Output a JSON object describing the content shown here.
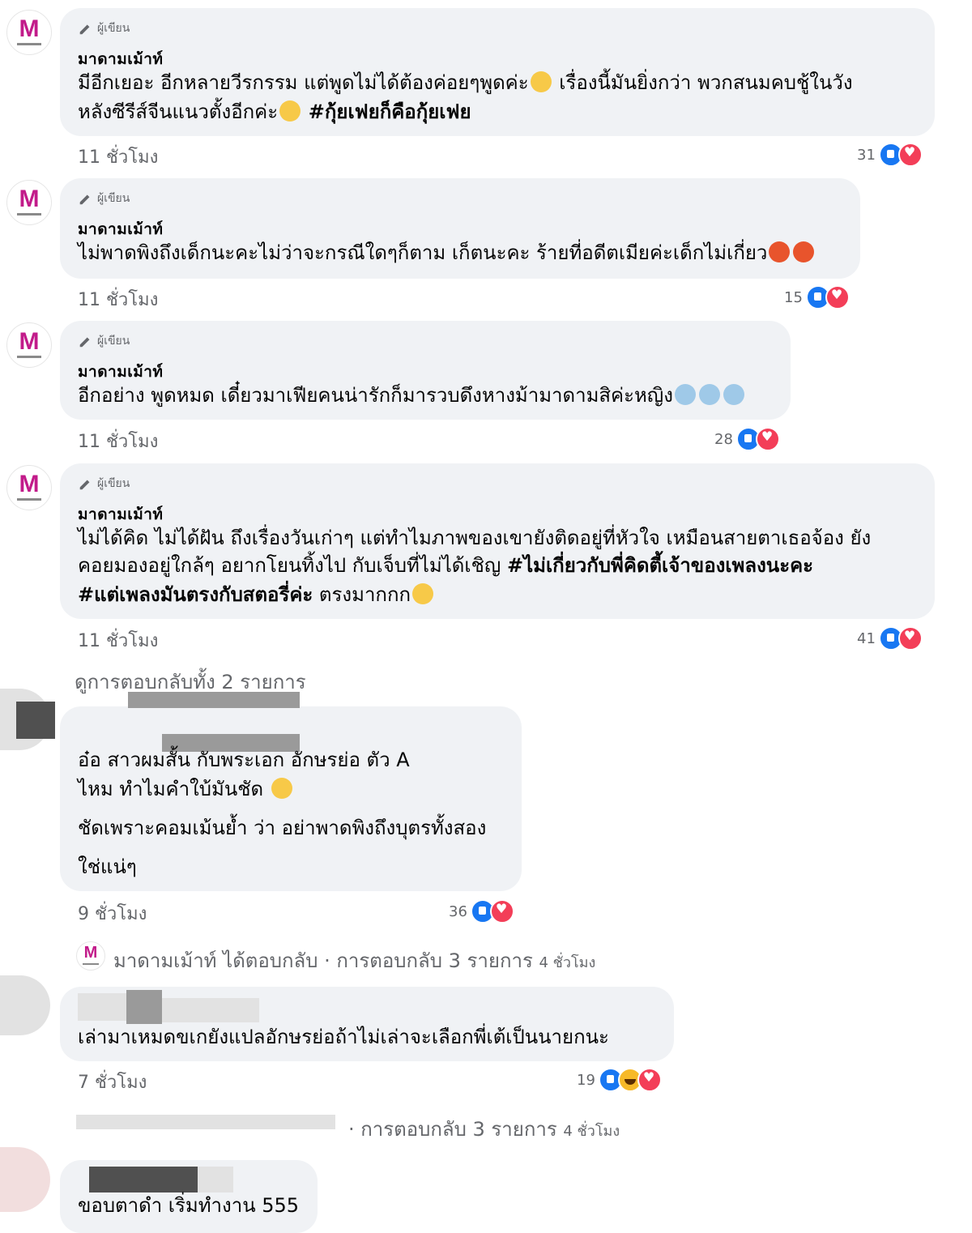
{
  "author_badge": "ผู้เขียน",
  "page_name": "มาดามเม้าท์",
  "comments": [
    {
      "line1": "มีอีกเยอะ อีกหลายวีรกรรม แต่พูดไม่ได้ต้องค่อยๆพูดค่ะ",
      "line1b": " เรื่องนี้มันยิ่งกว่า พวกสนมคบชู้ในวัง",
      "line2": "หลังซีรีส์จีนแนวตั้งอีกค่ะ",
      "hashtag": "#กุ้ยเฟยก็คือกุ้ยเฟย",
      "time": "11 ชั่วโมง",
      "count": "31"
    },
    {
      "line1": "ไม่พาดพิงถึงเด็กนะคะไม่ว่าจะกรณีใดๆก็ตาม เก็ตนะคะ ร้ายที่อดีตเมียค่ะเด็กไม่เกี่ยว",
      "time": "11 ชั่วโมง",
      "count": "15"
    },
    {
      "line1": "อีกอย่าง พูดหมด เดี๋ยวมาเฟียคนน่ารักก็มารวบดึงหางม้ามาดามสิค่ะหญิง",
      "time": "11 ชั่วโมง",
      "count": "28"
    },
    {
      "line1": "ไม่ได้คิด ไม่ได้ฝัน ถึงเรื่องวันเก่าๆ แต่ทำไมภาพของเขายังติดอยู่ที่หัวใจ เหมือนสายตาเธอจ้อง ยัง",
      "line2": "คอยมองอยู่ใกล้ๆ อยากโยนทิ้งไป กับเจ็บที่ไม่ได้เชิญ ",
      "hashtag1": "#ไม่เกี่ยวกับพี่คิดตี้เจ้าของเพลงนะคะ",
      "hashtag2": "#แต่เพลงมันตรงกับสตอรี่ค่ะ",
      "line3": " ตรงมากกก",
      "time": "11 ชั่วโมง",
      "count": "41"
    }
  ],
  "replies_link": "ดูการตอบกลับทั้ง 2 รายการ",
  "reply1": {
    "line1": "อ๋อ สาวผมสั้น กับพระเอก อักษรย่อ ตัว A",
    "line2": "ไหม ทำไมคำใบ้มันชัด",
    "line3": "ชัดเพราะคอมเม้นย้ำ ว่า อย่าพาดพิงถึงบุตรทั้งสอง",
    "line4": "ใช่แน่ๆ",
    "time": "9 ชั่วโมง",
    "count": "36"
  },
  "reply_meta1": {
    "text": "มาดามเม้าท์ ได้ตอบกลับ · การตอบกลับ 3 รายการ",
    "time": "4 ชั่วโมง"
  },
  "reply2": {
    "line1": "เล่ามาเหมดขเกยังแปลอักษรย่อถ้าไม่เล่าจะเลือกพี่เต้เป็นนายกนะ",
    "time": "7 ชั่วโมง",
    "count": "19"
  },
  "reply_meta2": {
    "text": "· การตอบกลับ 3 รายการ",
    "time": "4 ชั่วโมง"
  },
  "reply3": {
    "line1": "ขอบตาดำ เริ่มทำงาน 555"
  },
  "colors": {
    "bubble": "#f0f2f5",
    "like": "#1877f2",
    "love": "#f33e58",
    "brand": "#c21b8a",
    "muted": "#65676b"
  }
}
